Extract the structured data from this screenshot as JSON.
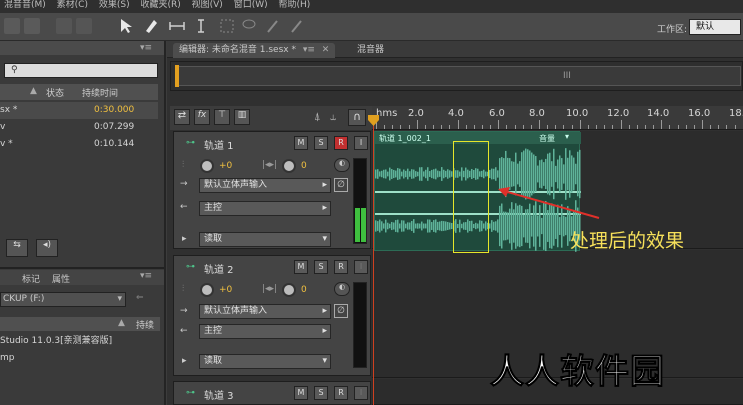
{
  "menu": [
    "混音音(M)",
    "素材(C)",
    "效果(S)",
    "收藏夹(R)",
    "视图(V)",
    "窗口(W)",
    "帮助(H)"
  ],
  "workspace": {
    "label": "工作区:",
    "value": "默认"
  },
  "files_panel": {
    "col_status": "状态",
    "col_duration": "持续时间",
    "files": [
      {
        "name": "sx *",
        "duration": "0:30.000"
      },
      {
        "name": "v",
        "duration": "0:07.299"
      },
      {
        "name": "v *",
        "duration": "0:10.144"
      }
    ]
  },
  "media_panel": {
    "tab_markers": "标记",
    "tab_properties": "属性",
    "drive": "CKUP (F:)",
    "col_duration": "持续",
    "items": [
      "Studio 11.0.3[亲测兼容版]",
      "mp"
    ]
  },
  "editor": {
    "tab_editor": "编辑器: 未命名混音 1.sesx *",
    "tab_mixer": "混音器",
    "overview_marker": "III"
  },
  "ruler": {
    "unit": "hms",
    "labels": [
      "2.0",
      "4.0",
      "6.0",
      "8.0",
      "10.0",
      "12.0",
      "14.0",
      "16.0",
      "18."
    ]
  },
  "tracks": [
    {
      "name": "轨道 1",
      "volume": "+0",
      "pan": "0",
      "input": "默认立体声输入",
      "output": "主控",
      "read": "读取",
      "clip_name": "轨道 1_002_1",
      "clip_label": "音量",
      "armed": true
    },
    {
      "name": "轨道 2",
      "volume": "+0",
      "pan": "0",
      "input": "默认立体声输入",
      "output": "主控",
      "read": "读取",
      "armed": false
    },
    {
      "name": "轨道 3"
    }
  ],
  "track_buttons": {
    "mute": "M",
    "solo": "S",
    "record": "R",
    "input": "I"
  },
  "annotation": "处理后的效果",
  "watermark": "人人软件园",
  "colors": {
    "waveform": "#5fb39a",
    "clip_bg": "#1f4a3c",
    "selection_box": "#e6e62a",
    "arrow": "#e0302a",
    "playhead": "#e0a020"
  }
}
